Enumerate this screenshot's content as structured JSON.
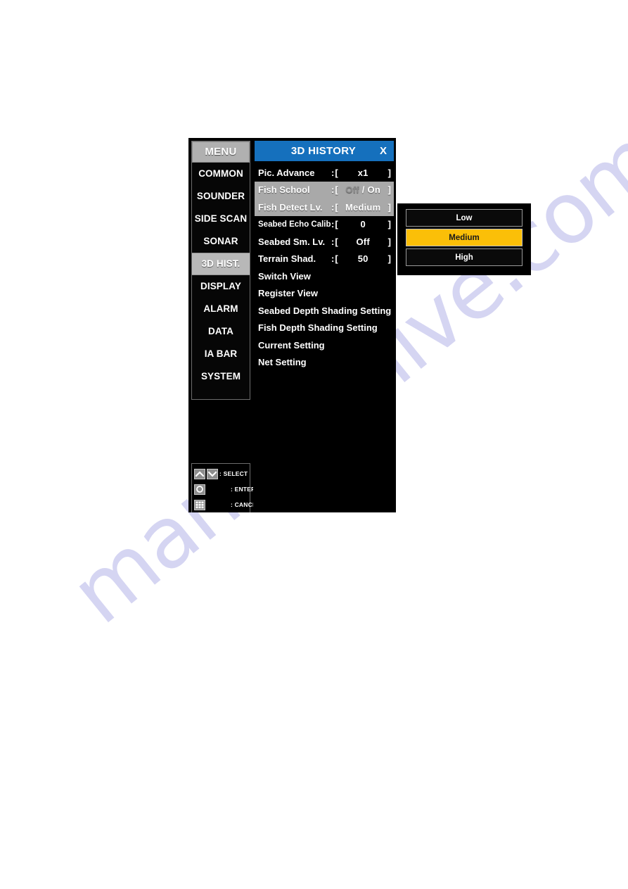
{
  "watermark": {
    "text": "manualshive.com"
  },
  "sidebar": {
    "header_label": "MENU",
    "items": [
      {
        "label": "COMMON",
        "active": false
      },
      {
        "label": "SOUNDER",
        "active": false
      },
      {
        "label": "SIDE SCAN",
        "active": false
      },
      {
        "label": "SONAR",
        "active": false
      },
      {
        "label": "3D HIST.",
        "active": true
      },
      {
        "label": "DISPLAY",
        "active": false
      },
      {
        "label": "ALARM",
        "active": false
      },
      {
        "label": "DATA",
        "active": false
      },
      {
        "label": "IA BAR",
        "active": false
      },
      {
        "label": "SYSTEM",
        "active": false
      }
    ],
    "legend": [
      {
        "label": ": SELECT",
        "icons": [
          "chevron-up-icon",
          "chevron-down-icon"
        ]
      },
      {
        "label": ": ENTER",
        "icons": [
          "circle-icon"
        ]
      },
      {
        "label": ": CANCEL",
        "icons": [
          "keypad-grid-icon"
        ]
      }
    ]
  },
  "panel": {
    "title": "3D HISTORY",
    "close_label": "X",
    "rows": [
      {
        "label": "Pic. Advance",
        "type": "value",
        "value": "x1"
      },
      {
        "label": "Fish School",
        "type": "toggle",
        "options": [
          "Off",
          "On"
        ],
        "selected": "On"
      },
      {
        "label": "Fish Detect Lv.",
        "type": "value",
        "value": "Medium",
        "selected": true
      },
      {
        "label": "Seabed Echo Calib.",
        "type": "value",
        "value": "0",
        "narrow": true
      },
      {
        "label": "Seabed Sm. Lv.",
        "type": "value",
        "value": "Off"
      },
      {
        "label": "Terrain Shad.",
        "type": "value",
        "value": "50"
      },
      {
        "label": "Switch View",
        "type": "plain"
      },
      {
        "label": "Register View",
        "type": "plain"
      },
      {
        "label": "Seabed Depth Shading Setting",
        "type": "plain"
      },
      {
        "label": "Fish Depth Shading Setting",
        "type": "plain"
      },
      {
        "label": "Current Setting",
        "type": "plain"
      },
      {
        "label": "Net Setting",
        "type": "plain"
      }
    ]
  },
  "popup": {
    "options": [
      {
        "label": "Low",
        "selected": false
      },
      {
        "label": "Medium",
        "selected": true
      },
      {
        "label": "High",
        "selected": false
      }
    ]
  },
  "colors": {
    "title_bar_blue": "#1570bd",
    "highlight_yellow": "#fbbf08",
    "selected_gray": "#a9a9a9",
    "menu_header_gray": "#b0b0b0",
    "watermark_lavender": "#d5d5f2"
  }
}
